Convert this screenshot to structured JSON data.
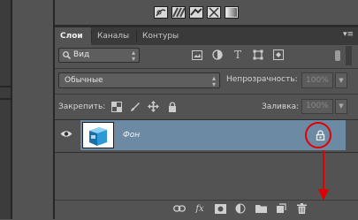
{
  "tabs": [
    {
      "label": "Слои"
    },
    {
      "label": "Каналы"
    },
    {
      "label": "Контуры"
    }
  ],
  "panel_menu_icon": "panel-menu-icon",
  "filter": {
    "selected": "Вид",
    "icons": [
      "image-filter-icon",
      "adjustment-filter-icon",
      "type-filter-icon",
      "shape-filter-icon",
      "smart-object-filter-icon"
    ]
  },
  "blend": {
    "selected": "Обычные",
    "opacity_label": "Непрозрачность:",
    "opacity_value": "100%"
  },
  "lock": {
    "label": "Закрепить:",
    "icons": [
      "lock-transparent-icon",
      "lock-image-icon",
      "lock-position-icon",
      "lock-all-icon"
    ],
    "fill_label": "Заливка:",
    "fill_value": "100%"
  },
  "layers": [
    {
      "name": "Фон",
      "visible": true,
      "locked": true,
      "selected": true
    }
  ],
  "bottom_icons": [
    "link-icon",
    "fx-icon",
    "mask-icon",
    "adjustment-layer-icon",
    "group-folder-icon",
    "new-layer-icon",
    "trash-icon"
  ],
  "annotation": {
    "color": "#e00000"
  },
  "colors": {
    "panel_bg": "#535353",
    "selection": "#6c8aa4",
    "tab_bar": "#3a3a3a"
  }
}
